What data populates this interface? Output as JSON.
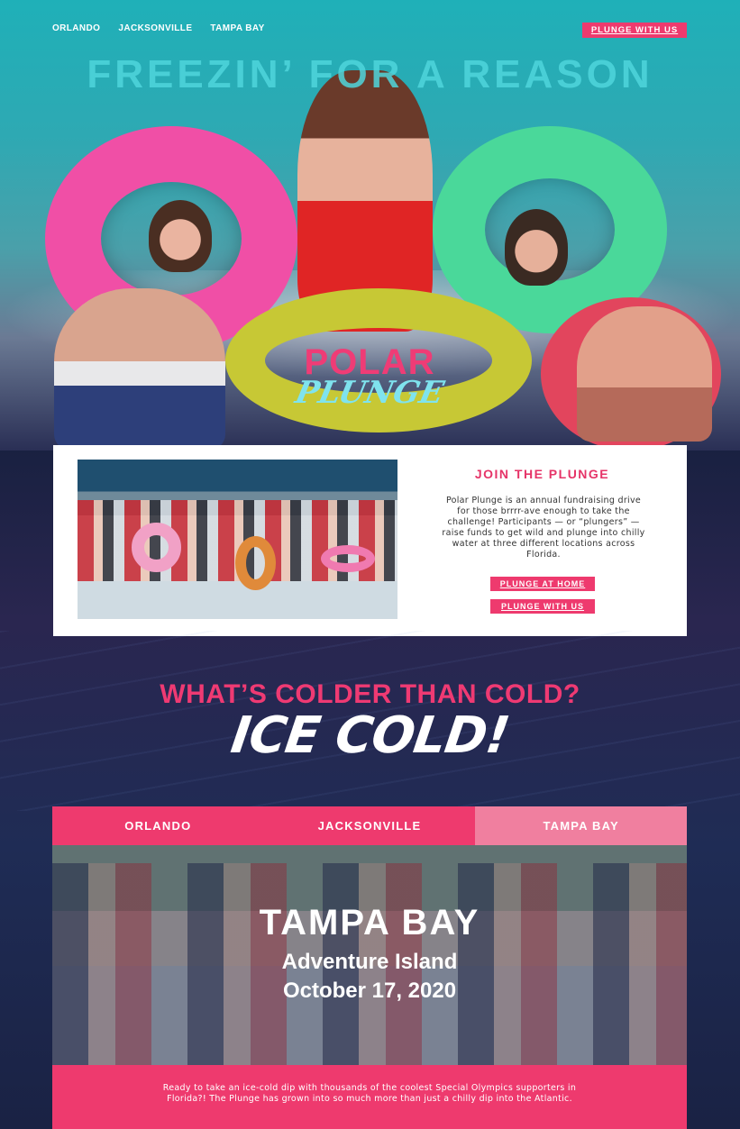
{
  "nav": {
    "links": [
      "ORLANDO",
      "JACKSONVILLE",
      "TAMPA BAY"
    ],
    "cta": "PLUNGE WITH US"
  },
  "hero": {
    "tagline": "FREEZIN’ FOR A REASON",
    "logo_top": "POLAR",
    "logo_bottom": "PLUNGE"
  },
  "intro": {
    "title": "JOIN THE PLUNGE",
    "text": "Polar Plunge is an annual fundraising drive for those brrrr-ave enough to take the challenge! Participants — or “plungers” — raise funds to get wild and plunge into chilly water at three different locations across Florida.",
    "button_home": "PLUNGE AT HOME",
    "button_with": "PLUNGE WITH US"
  },
  "headline": {
    "line1": "WHAT’S COLDER THAN COLD?",
    "line2": "ICE COLD!"
  },
  "locations": {
    "tabs": [
      "ORLANDO",
      "JACKSONVILLE",
      "TAMPA BAY"
    ],
    "active_tab": "TAMPA BAY",
    "city": "TAMPA BAY",
    "venue": "Adventure Island",
    "date": "October 17, 2020",
    "description": "Ready to take an ice-cold dip with thousands of the coolest Special Olympics supporters in Florida?! The Plunge has grown into so much more than just a chilly dip into the Atlantic."
  },
  "colors": {
    "accent": "#ee3a6e",
    "tab_active": "#f07f9f",
    "tagline": "#4fd6dc",
    "plunge_text": "#7fe3ee"
  }
}
